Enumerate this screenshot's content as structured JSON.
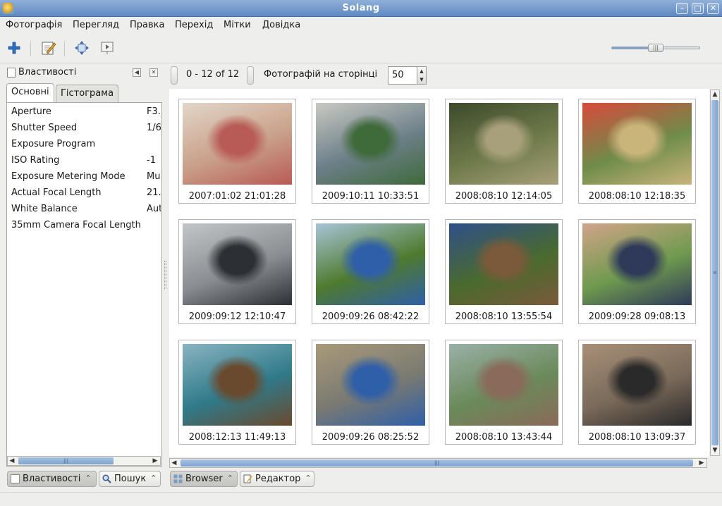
{
  "window": {
    "title": "Solang"
  },
  "menu": [
    "Фотографія",
    "Перегляд",
    "Правка",
    "Перехід",
    "Мітки",
    "Довідка"
  ],
  "toolbar": {
    "icons": [
      "add-icon",
      "edit-icon",
      "fullscreen-icon",
      "slideshow-icon"
    ],
    "zoom_level": 0.48
  },
  "left_panel": {
    "title": "Властивості",
    "tabs": [
      "Основні",
      "Гістограма"
    ],
    "properties": [
      {
        "name": "Aperture",
        "value": "F3."
      },
      {
        "name": "Shutter Speed",
        "value": "1/6"
      },
      {
        "name": "Exposure Program",
        "value": ""
      },
      {
        "name": "ISO Rating",
        "value": "-1"
      },
      {
        "name": "Exposure Metering Mode",
        "value": "Mu"
      },
      {
        "name": "Actual Focal Length",
        "value": "21."
      },
      {
        "name": "White Balance",
        "value": "Aut"
      },
      {
        "name": "35mm Camera Focal Length",
        "value": ""
      }
    ],
    "bottom_tabs": [
      "Властивості",
      "Пошук"
    ]
  },
  "paging": {
    "range": "0 - 12 of 12",
    "per_page_label": "Фотографій на сторінці",
    "per_page_value": "50"
  },
  "photos": [
    {
      "date": "2007:01:02 21:01:28",
      "colors": [
        "#c9a08a",
        "#b85a55",
        "#e2d6c8"
      ]
    },
    {
      "date": "2009:10:11 10:33:51",
      "colors": [
        "#6c7f88",
        "#3f6a3a",
        "#c9c9c2"
      ]
    },
    {
      "date": "2008:08:10 12:14:05",
      "colors": [
        "#6f7a4a",
        "#a8a07a",
        "#3c4a2c"
      ]
    },
    {
      "date": "2008:08:10 12:18:35",
      "colors": [
        "#6f8c4a",
        "#c9b47a",
        "#d84a3a"
      ]
    },
    {
      "date": "2009:09:12 12:10:47",
      "colors": [
        "#8a8e92",
        "#2c2f33",
        "#c2c6c8"
      ]
    },
    {
      "date": "2009:09:26 08:42:22",
      "colors": [
        "#4f7a2e",
        "#2f5fa8",
        "#a8c4d8"
      ]
    },
    {
      "date": "2008:08:10 13:55:54",
      "colors": [
        "#4a6a2e",
        "#7a5a3a",
        "#2f4f8a"
      ]
    },
    {
      "date": "2009:09:28 09:08:13",
      "colors": [
        "#6f9a4e",
        "#2f3a5a",
        "#d2a48a"
      ]
    },
    {
      "date": "2008:12:13 11:49:13",
      "colors": [
        "#2f7a8a",
        "#6a4a2e",
        "#8ab4c0"
      ]
    },
    {
      "date": "2009:09:26 08:25:52",
      "colors": [
        "#7a7a72",
        "#2f5fa8",
        "#a89a7a"
      ]
    },
    {
      "date": "2008:08:10 13:43:44",
      "colors": [
        "#6a8a5a",
        "#8a6a5a",
        "#9ab0a8"
      ]
    },
    {
      "date": "2008:08:10 13:09:37",
      "colors": [
        "#7a6a5a",
        "#2a2a2a",
        "#a89078"
      ]
    }
  ],
  "bottom_tabs": [
    "Browser",
    "Редактор"
  ],
  "colors": {
    "titlebar": "#5f89c2",
    "scroll_thumb": "#7ea3cf",
    "add_icon": "#2f6fc0"
  }
}
